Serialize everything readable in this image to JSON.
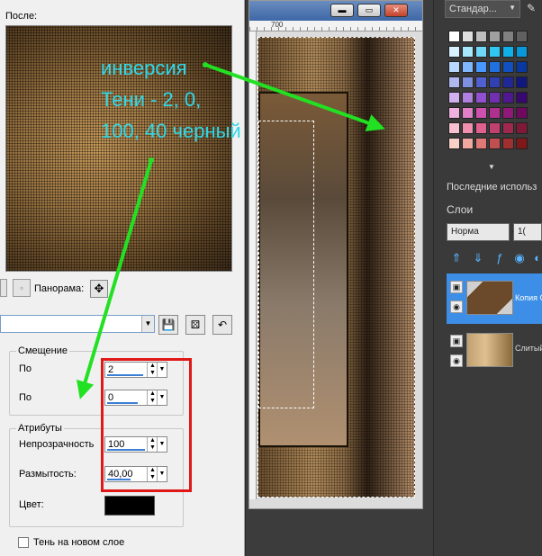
{
  "dialog": {
    "after_label": "После:",
    "pan_label": "Панорама:",
    "offset_group": "Смещение",
    "offset_x_label": "По",
    "offset_x_value": "2",
    "offset_y_label": "По",
    "offset_y_value": "0",
    "attr_group": "Атрибуты",
    "opacity_label": "Непрозрачность",
    "opacity_value": "100",
    "blur_label": "Размытость:",
    "blur_value": "40,00",
    "color_label": "Цвет:",
    "shadow_layer_label": "Тень на новом слое",
    "shadow_color": "#000000"
  },
  "image_window": {
    "ruler_mark": "700"
  },
  "right_panel": {
    "palette_name": "Стандар...",
    "recent_label": "Последние использ",
    "layers_title": "Слои",
    "blend_mode": "Норма",
    "opacity_partial": "1(",
    "layers": [
      {
        "name": "Копия С"
      },
      {
        "name": "Слитый"
      }
    ]
  },
  "annotation": {
    "text": "инверсия\nТени - 2, 0,\n100, 40 черный",
    "text_color": "#30d8e8",
    "arrow_color": "#22e022",
    "box_color": "#e01818"
  }
}
